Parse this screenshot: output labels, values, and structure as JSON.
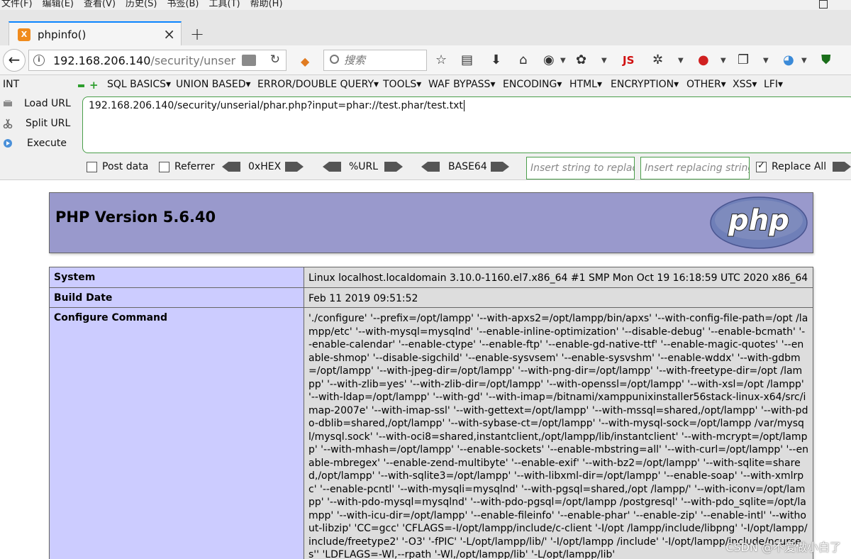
{
  "menubar": {
    "items": [
      "文件(F)",
      "编辑(E)",
      "查看(V)",
      "历史(S)",
      "书签(B)",
      "工具(T)",
      "帮助(H)"
    ]
  },
  "tab": {
    "title": "phpinfo()",
    "favicon_icon": "xampp-icon",
    "favicon_glyph": "X"
  },
  "navbar": {
    "url_host": "192.168.206.140",
    "url_path": "/security/unser",
    "search_placeholder": "搜索",
    "js_label": "JS"
  },
  "hackbar": {
    "type_select": "INT",
    "menu": [
      "SQL BASICS",
      "UNION BASED",
      "ERROR/DOUBLE QUERY",
      "TOOLS",
      "WAF BYPASS",
      "ENCODING",
      "HTML",
      "ENCRYPTION",
      "OTHER",
      "XSS",
      "LFI"
    ],
    "actions": {
      "load": "Load URL",
      "split": "Split URL",
      "execute": "Execute"
    },
    "url_value": "192.168.206.140/security/unserial/phar.php?input=phar://test.phar/test.txt",
    "options": {
      "post_data": "Post data",
      "referrer": "Referrer",
      "hex": "0xHEX",
      "url": "%URL",
      "base64": "BASE64",
      "insert_replace_placeholder": "Insert string to replace",
      "insert_replacing_placeholder": "Insert replacing string",
      "replace_all": "Replace All",
      "replace_all_checked": true
    }
  },
  "page": {
    "version_title": "PHP Version 5.6.40",
    "logo_text": "php",
    "rows": [
      {
        "label": "System",
        "value": "Linux localhost.localdomain 3.10.0-1160.el7.x86_64 #1 SMP Mon Oct 19 16:18:59 UTC 2020 x86_64"
      },
      {
        "label": "Build Date",
        "value": "Feb 11 2019 09:51:52"
      },
      {
        "label": "Configure Command",
        "value": "'./configure' '--prefix=/opt/lampp' '--with-apxs2=/opt/lampp/bin/apxs' '--with-config-file-path=/opt /lampp/etc' '--with-mysql=mysqlnd' '--enable-inline-optimization' '--disable-debug' '--enable-bcmath' '--enable-calendar' '--enable-ctype' '--enable-ftp' '--enable-gd-native-ttf' '--enable-magic-quotes' '--enable-shmop' '--disable-sigchild' '--enable-sysvsem' '--enable-sysvshm' '--enable-wddx' '--with-gdbm=/opt/lampp' '--with-jpeg-dir=/opt/lampp' '--with-png-dir=/opt/lampp' '--with-freetype-dir=/opt /lampp' '--with-zlib=yes' '--with-zlib-dir=/opt/lampp' '--with-openssl=/opt/lampp' '--with-xsl=/opt /lampp' '--with-ldap=/opt/lampp' '--with-gd' '--with-imap=/bitnami/xamppunixinstaller56stack-linux-x64/src/imap-2007e' '--with-imap-ssl' '--with-gettext=/opt/lampp' '--with-mssql=shared,/opt/lampp' '--with-pdo-dblib=shared,/opt/lampp' '--with-sybase-ct=/opt/lampp' '--with-mysql-sock=/opt/lampp /var/mysql/mysql.sock' '--with-oci8=shared,instantclient,/opt/lampp/lib/instantclient' '--with-mcrypt=/opt/lampp' '--with-mhash=/opt/lampp' '--enable-sockets' '--enable-mbstring=all' '--with-curl=/opt/lampp' '--enable-mbregex' '--enable-zend-multibyte' '--enable-exif' '--with-bz2=/opt/lampp' '--with-sqlite=shared,/opt/lampp' '--with-sqlite3=/opt/lampp' '--with-libxml-dir=/opt/lampp' '--enable-soap' '--with-xmlrpc' '--enable-pcntl' '--with-mysqli=mysqlnd' '--with-pgsql=shared,/opt /lampp/' '--with-iconv=/opt/lampp' '--with-pdo-mysql=mysqlnd' '--with-pdo-pgsql=/opt/lampp /postgresql' '--with-pdo_sqlite=/opt/lampp' '--with-icu-dir=/opt/lampp' '--enable-fileinfo' '--enable-phar' '--enable-zip' '--enable-intl' '--without-libzip' 'CC=gcc' 'CFLAGS=-I/opt/lampp/include/c-client '-I/opt /lampp/include/libpng' '-I/opt/lampp/include/freetype2' '-O3' '-fPIC' '-L/opt/lampp/lib/' '-I/opt/lampp /include' '-I/opt/lampp/include/ncurses'' 'LDFLAGS=-Wl,--rpath '-Wl,/opt/lampp/lib' '-L/opt/lampp/lib'"
      }
    ],
    "watermark": "CSDN @不爱做小白了"
  }
}
